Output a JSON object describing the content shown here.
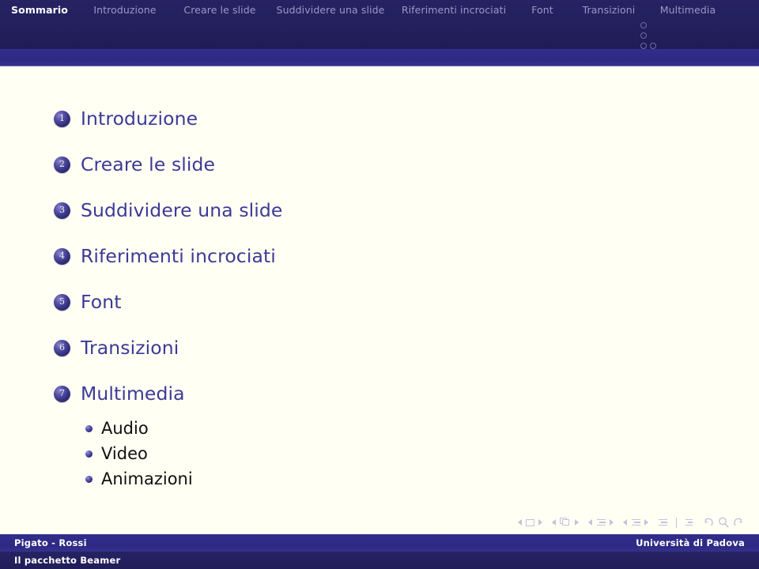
{
  "header": {
    "nav_items": [
      {
        "label": "Sommario",
        "active": true
      },
      {
        "label": "Introduzione",
        "active": false
      },
      {
        "label": "Creare le slide",
        "active": false
      },
      {
        "label": "Suddividere una slide",
        "active": false
      },
      {
        "label": "Riferimenti incrociati",
        "active": false
      },
      {
        "label": "Font",
        "active": false
      },
      {
        "label": "Transizioni",
        "active": false
      },
      {
        "label": "Multimedia",
        "active": false
      }
    ],
    "subsection_dots": [
      {
        "count": 1
      },
      {
        "count": 1
      },
      {
        "count": 2
      }
    ]
  },
  "toc": {
    "entries": [
      {
        "number": "1",
        "title": "Introduzione",
        "subitems": []
      },
      {
        "number": "2",
        "title": "Creare le slide",
        "subitems": []
      },
      {
        "number": "3",
        "title": "Suddividere una slide",
        "subitems": []
      },
      {
        "number": "4",
        "title": "Riferimenti incrociati",
        "subitems": []
      },
      {
        "number": "5",
        "title": "Font",
        "subitems": []
      },
      {
        "number": "6",
        "title": "Transizioni",
        "subitems": []
      },
      {
        "number": "7",
        "title": "Multimedia",
        "subitems": [
          "Audio",
          "Video",
          "Animazioni"
        ]
      }
    ]
  },
  "nav_symbols": {
    "items": [
      "prev-slide-icon",
      "slide-icon",
      "next-slide-icon",
      "prev-frame-icon",
      "frame-icon",
      "next-frame-icon",
      "prev-subsection-icon",
      "subsection-icon",
      "next-subsection-icon",
      "prev-section-icon",
      "section-icon",
      "next-section-icon",
      "beginning-of-presentation-icon",
      "table-of-contents-icon",
      "back-icon",
      "search-icon",
      "forward-icon"
    ]
  },
  "footer": {
    "author": "Pigato - Rossi",
    "institute": "Università di Padova",
    "title": "Il pacchetto Beamer"
  },
  "colors": {
    "dark_navy": "#221f5e",
    "mid_blue": "#2e2b86",
    "toc_text": "#3b3a97",
    "nav_inactive": "#9a98c4",
    "nav_active": "#ffffff",
    "page_bg": "#fffff4"
  }
}
